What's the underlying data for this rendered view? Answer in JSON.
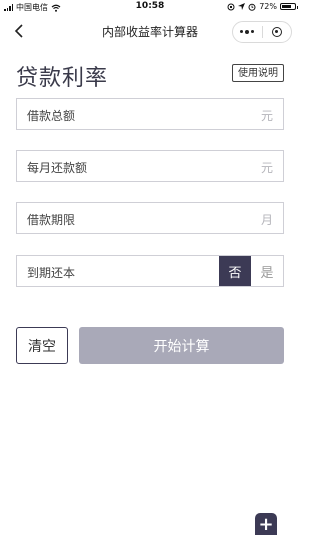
{
  "status_bar": {
    "carrier": "中国电信",
    "time": "10:58",
    "battery": "72%",
    "battery_level": 0.72
  },
  "nav": {
    "title": "内部收益率计算器",
    "back_icon": "chevron-left-icon",
    "more_icon": "more-dots-icon",
    "close_icon": "target-icon"
  },
  "header": {
    "title": "贷款利率",
    "help_label": "使用说明"
  },
  "fields": [
    {
      "label": "借款总额",
      "unit": "元",
      "value": ""
    },
    {
      "label": "每月还款额",
      "unit": "元",
      "value": ""
    },
    {
      "label": "借款期限",
      "unit": "月",
      "value": ""
    }
  ],
  "repay_at_maturity": {
    "label": "到期还本",
    "option_no": "否",
    "option_yes": "是",
    "selected": "否"
  },
  "actions": {
    "clear_label": "清空",
    "calculate_label": "开始计算"
  },
  "fab": {
    "icon": "plus-icon",
    "symbol": "+"
  },
  "colors": {
    "accent": "#3c3a55",
    "disabled_button": "#a9a9b8",
    "border": "#cfcfd6"
  }
}
